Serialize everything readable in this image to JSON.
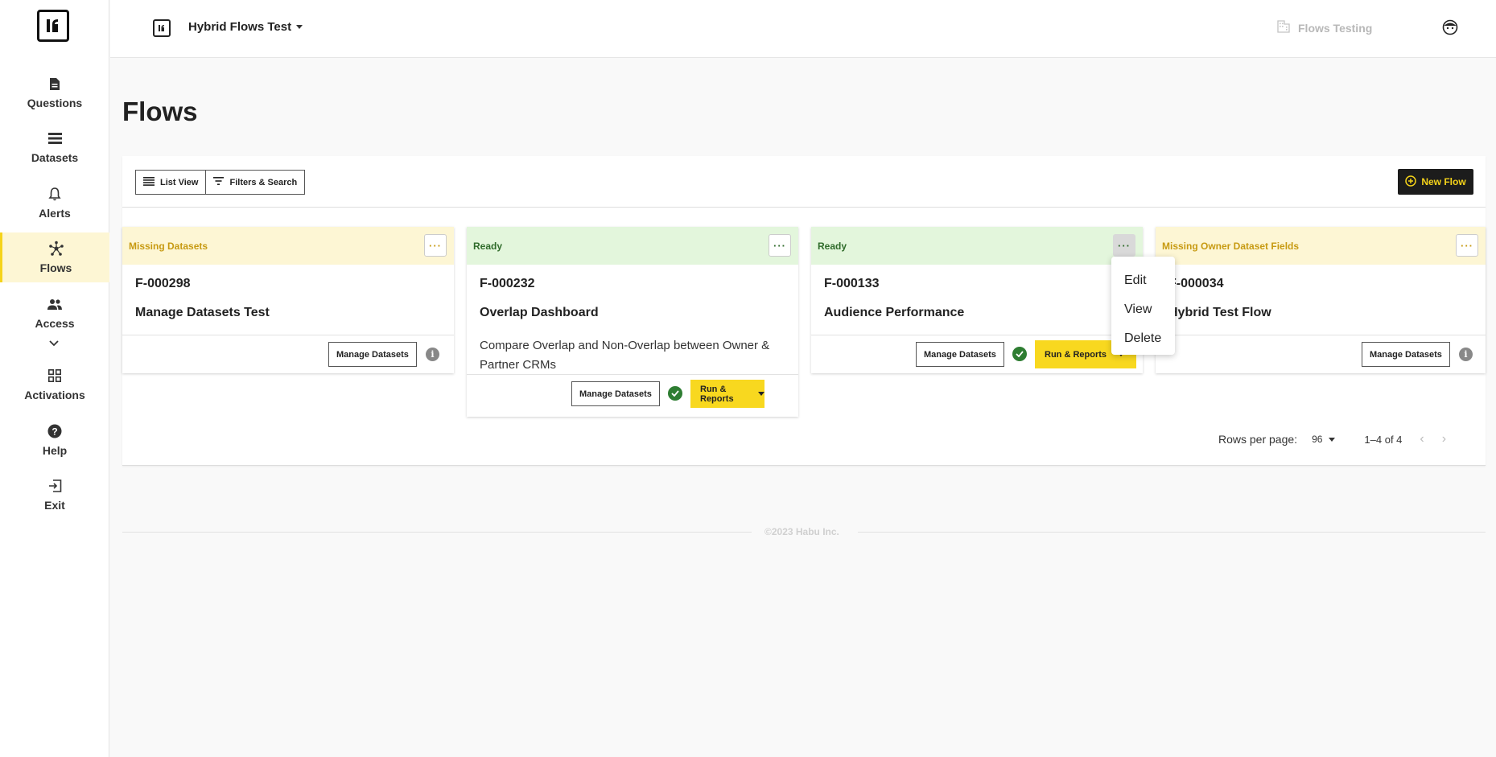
{
  "app": {
    "logo": "ᴴ",
    "workspace": "Hybrid Flows Test",
    "organization": "Flows Testing"
  },
  "sidebar": {
    "items": [
      {
        "label": "Questions",
        "icon": "document-icon"
      },
      {
        "label": "Datasets",
        "icon": "list-icon"
      },
      {
        "label": "Alerts",
        "icon": "bell-icon"
      },
      {
        "label": "Flows",
        "icon": "flows-icon",
        "active": true
      },
      {
        "label": "Access",
        "icon": "people-icon"
      },
      {
        "label": "Activations",
        "icon": "grid-icon"
      },
      {
        "label": "Help",
        "icon": "help-icon"
      },
      {
        "label": "Exit",
        "icon": "exit-icon"
      }
    ]
  },
  "page": {
    "title": "Flows"
  },
  "toolbar": {
    "list_view": "List View",
    "filters": "Filters & Search",
    "new_flow": "New Flow"
  },
  "cards": [
    {
      "status": "Missing Datasets",
      "status_type": "warn",
      "id": "F-000298",
      "name": "Manage Datasets Test",
      "description": "",
      "manage": "Manage Datasets",
      "info": "i"
    },
    {
      "status": "Ready",
      "status_type": "ok",
      "id": "F-000232",
      "name": "Overlap Dashboard",
      "description": "Compare Overlap and Non-Overlap between Owner & Partner CRMs",
      "manage": "Manage Datasets",
      "run": "Run & Reports"
    },
    {
      "status": "Ready",
      "status_type": "ok",
      "id": "F-000133",
      "name": "Audience Performance",
      "description": "",
      "manage": "Manage Datasets",
      "run": "Run & Reports"
    },
    {
      "status": "Missing Owner Dataset Fields",
      "status_type": "warn",
      "id": "F-000034",
      "name": "Hybrid Test Flow",
      "description": "",
      "manage": "Manage Datasets",
      "info": "i"
    }
  ],
  "more_label": "···",
  "context_menu": {
    "items": [
      "Edit",
      "View",
      "Delete"
    ]
  },
  "pagination": {
    "rows_per_page_label": "Rows per page:",
    "rows_per_page": "96",
    "range": "1–4 of 4",
    "prev": "‹",
    "next": "›"
  },
  "footer": {
    "copyright": "©2023 Habu Inc."
  },
  "colors": {
    "accent": "#f8d81f",
    "ready": "#e3f6dc",
    "warning": "#fdf6d4",
    "success": "#2e7d32"
  }
}
